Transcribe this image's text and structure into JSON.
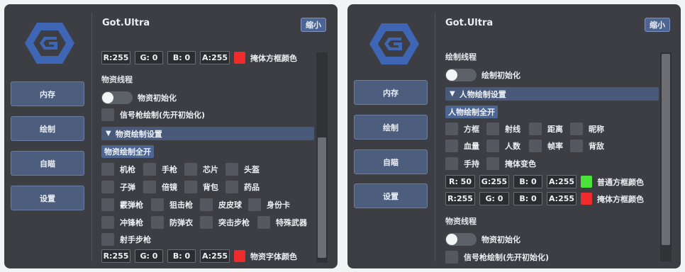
{
  "left": {
    "title": "Got.Ultra",
    "shrink": "缩小",
    "nav": [
      "内存",
      "绘制",
      "自瞄",
      "设置"
    ],
    "top_color": {
      "r": "R:255",
      "g": "G: 0",
      "b": "B: 0",
      "a": "A:255",
      "color": "#ef2b2b",
      "label": "掩体方框颜色"
    },
    "section": "物资线程",
    "init_toggle": "物资初始化",
    "flare_check": "信号枪绘制(先开初始化)",
    "header": "物资绘制设置",
    "all_btn": "物资绘制全开",
    "items": [
      "机枪",
      "手枪",
      "芯片",
      "头盔",
      "子弹",
      "倍镜",
      "背包",
      "药品",
      "霰弹枪",
      "狙击枪",
      "皮皮球",
      "身份卡",
      "冲锋枪",
      "防弹衣",
      "突击步枪",
      "特殊武器",
      "射手步枪"
    ],
    "bottom_color": {
      "r": "R:255",
      "g": "G: 0",
      "b": "B: 0",
      "a": "A:255",
      "color": "#ef2b2b",
      "label": "物资字体颜色"
    }
  },
  "right": {
    "title": "Got.Ultra",
    "shrink": "缩小",
    "nav": [
      "内存",
      "绘制",
      "自瞄",
      "设置"
    ],
    "section1": "绘制线程",
    "draw_toggle": "绘制初始化",
    "header": "人物绘制设置",
    "all_btn": "人物绘制全开",
    "items": [
      "方框",
      "射线",
      "距离",
      "昵称",
      "血量",
      "人数",
      "帧率",
      "背敌",
      "手持",
      "掩体变色"
    ],
    "color1": {
      "r": "R: 50",
      "g": "G:255",
      "b": "B: 0",
      "a": "A:255",
      "color": "#4be33a",
      "label": "普通方框颜色"
    },
    "color2": {
      "r": "R:255",
      "g": "G: 0",
      "b": "B: 0",
      "a": "A:255",
      "color": "#ef2b2b",
      "label": "掩体方框颜色"
    },
    "section2": "物资线程",
    "material_toggle": "物资初始化",
    "flare_check": "信号枪绘制(先开初始化)"
  },
  "colors": {
    "panel_bg": "#3c3e43",
    "nav_button": "#4c5d7e",
    "accent": "#4c6592",
    "header_bar": "#48597a",
    "logo": "#3f66b4"
  },
  "icons": {
    "logo": "hexagon-g-logo-icon",
    "caret": "caret-down-icon"
  }
}
